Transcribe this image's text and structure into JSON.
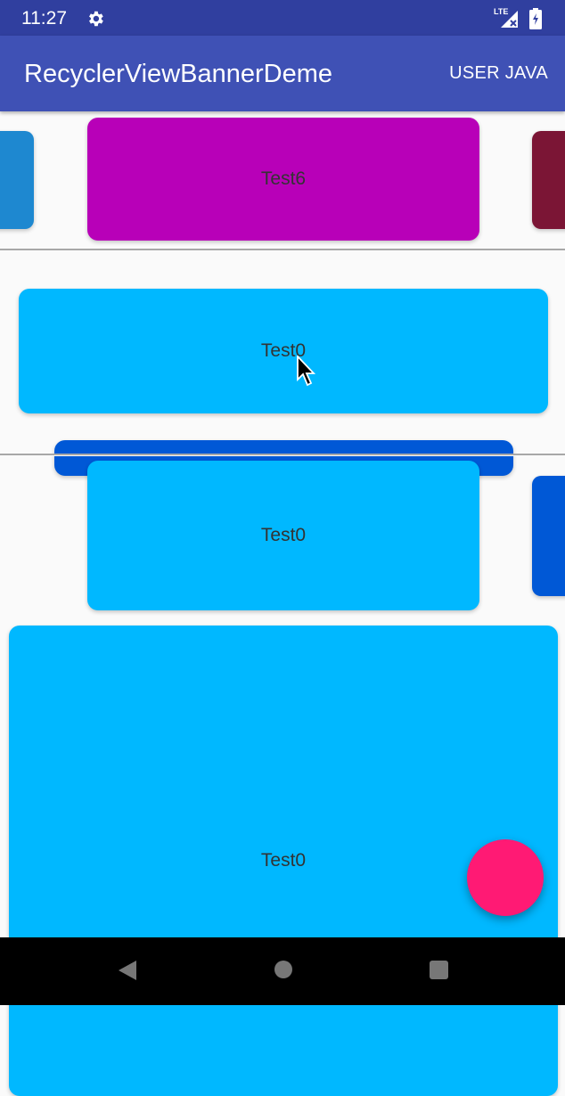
{
  "status_bar": {
    "time": "11:27",
    "network": "LTE",
    "icons": [
      "gear-icon",
      "signal-icon",
      "battery-icon"
    ]
  },
  "app_bar": {
    "title": "RecyclerViewBannerDeme",
    "action_label": "USER JAVA"
  },
  "banners": [
    {
      "name": "banner-1",
      "cards": [
        {
          "label": "",
          "color": "#1e88d0"
        },
        {
          "label": "Test6",
          "color": "#b800b8"
        },
        {
          "label": "",
          "color": "#7b1535"
        }
      ]
    },
    {
      "name": "banner-2",
      "cards": [
        {
          "label": "Test0",
          "color": "#00b8ff"
        },
        {
          "label": "",
          "color": "#0058d6"
        }
      ]
    },
    {
      "name": "banner-3",
      "cards": [
        {
          "label": "Test0",
          "color": "#00b8ff"
        },
        {
          "label": "",
          "color": "#0058d6"
        }
      ]
    },
    {
      "name": "banner-4",
      "cards": [
        {
          "label": "Test0",
          "color": "#00b8ff"
        }
      ]
    }
  ],
  "colors": {
    "status_bar": "#303f9f",
    "app_bar": "#3f51b5",
    "fab": "#ff1a74",
    "divider": "#a8a8a8"
  },
  "nav_bar": {
    "icons": [
      "back-icon",
      "home-icon",
      "recents-icon"
    ]
  }
}
